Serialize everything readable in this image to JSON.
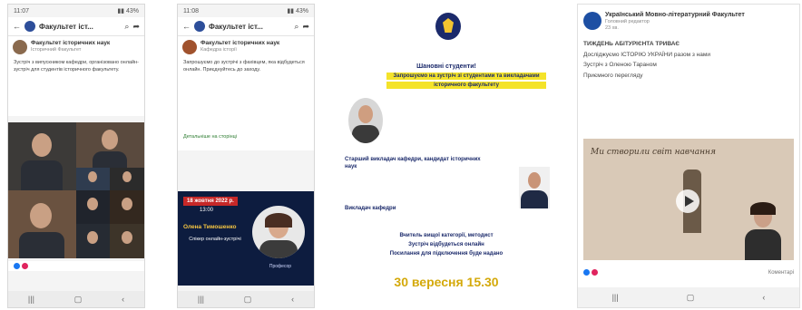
{
  "panels": [
    {
      "status": {
        "time": "11:07",
        "icons": "▮▮ 43%"
      },
      "page_title": "Факультет іст...",
      "author": "Факультет історичних наук",
      "group": "Історичний Факультет",
      "body": "Зустріч з випускником кафедри, організовано онлайн-зустріч для студентів історичного факультету.",
      "nav": [
        "|||",
        "▢",
        "‹"
      ]
    },
    {
      "status": {
        "time": "11:08",
        "icons": "▮▮ 43%"
      },
      "page_title": "Факультет іст...",
      "author": "Факультет історичних наук",
      "group": "Кафедра історії",
      "body": "Запрошуємо до зустрічі з фахівцем, яка відбудеться онлайн. Приєднуйтесь до заходу.",
      "link": "Детальніше на сторінці",
      "promo": {
        "date": "18 жовтня 2022 р.",
        "time": "13:00",
        "name": "Олена Тимошенко",
        "desc": "Спікер онлайн-зустрічі",
        "caption": "Професор"
      },
      "nav": [
        "|||",
        "▢",
        "‹"
      ]
    },
    {
      "greeting": "Шановні студенти!",
      "line1": "Запрошуємо на зустріч зі студентами та викладачами",
      "line2": "історичного факультету",
      "speaker1": "Старший викладач кафедри, кандидат історичних наук",
      "speaker2": "Викладач кафедри",
      "footer1": "Вчитель вищої категорії, методист",
      "footer2": "Зустріч відбудеться онлайн",
      "footer3": "Посилання для підключення буде надано",
      "date": "30 вересня 15.30"
    },
    {
      "author": "Український Мовно-літературний Факультет",
      "sub": "Головний редактор",
      "time": "23 хв.",
      "line1": "ТИЖДЕНЬ АБІТУРІЄНТА ТРИВАЄ",
      "line2": "Досліджуємо ІСТОРІЮ УКРАЇНИ разом з нами",
      "line3": "Зустріч з Оленою Тараном",
      "line4": "Приємного перегляду",
      "video_caption": "Ми створили світ навчання",
      "reactions": "Коментарі",
      "nav": [
        "|||",
        "▢",
        "‹"
      ]
    }
  ],
  "colors": {
    "fb_blue": "#1877f2",
    "promo_bg": "#0d1c3f",
    "highlight": "#f4e32a",
    "poster_text": "#1b2a6b"
  }
}
